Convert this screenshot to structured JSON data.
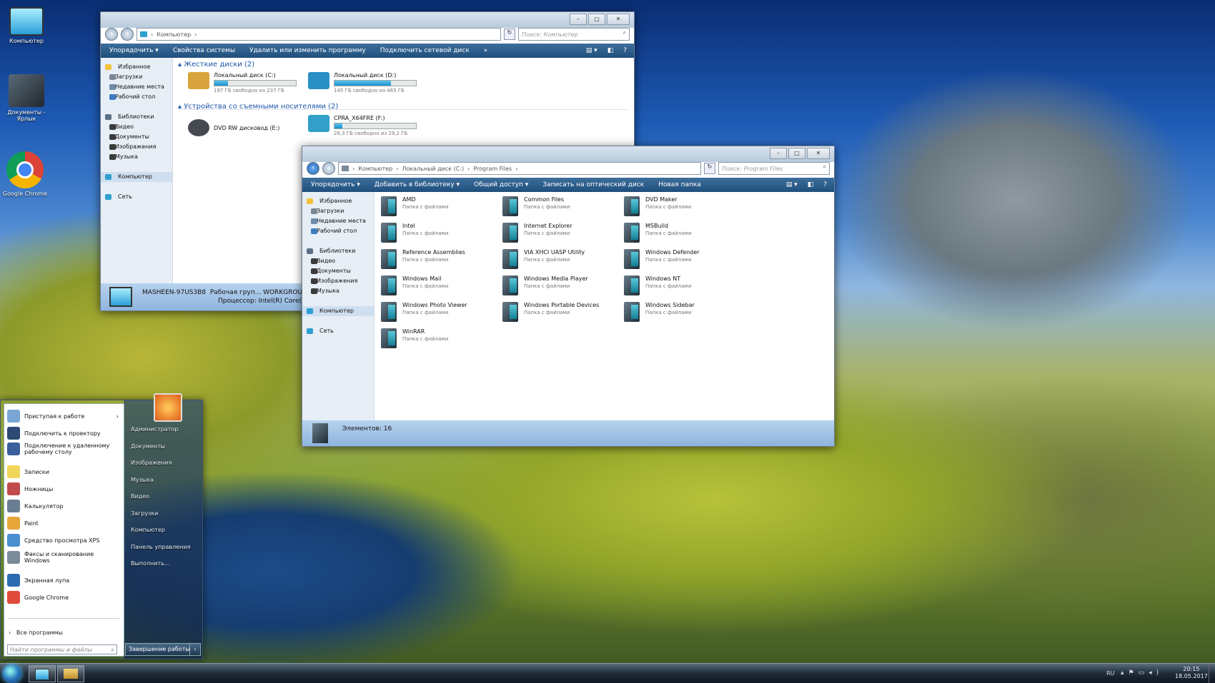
{
  "desktop": {
    "icons": [
      {
        "label": "Компьютер"
      },
      {
        "label": "Документы - Ярлык"
      },
      {
        "label": "Google Chrome"
      }
    ]
  },
  "window1": {
    "address": [
      "Компьютер"
    ],
    "search_placeholder": "Поиск: Компьютер",
    "toolbar": [
      "Упорядочить ▾",
      "Свойства системы",
      "Удалить или изменить программу",
      "Подключить сетевой диск",
      "»"
    ],
    "nav": [
      {
        "label": "Избранное",
        "group": true,
        "color": "#f2c23a"
      },
      {
        "label": "Загрузки",
        "group": false,
        "color": "#7b8896"
      },
      {
        "label": "Недавние места",
        "group": false,
        "color": "#6f8aa6"
      },
      {
        "label": "Рабочий стол",
        "group": false,
        "color": "#3d7bc2"
      },
      {
        "label": "Библиотеки",
        "group": true,
        "color": "#5c6f84"
      },
      {
        "label": "Видео",
        "group": false,
        "color": "#3b3b3b"
      },
      {
        "label": "Документы",
        "group": false,
        "color": "#3b3b3b"
      },
      {
        "label": "Изображения",
        "group": false,
        "color": "#3b3b3b"
      },
      {
        "label": "Музыка",
        "group": false,
        "color": "#3b3b3b"
      },
      {
        "label": "Компьютер",
        "group": true,
        "sel": true,
        "color": "#2f9fd1"
      },
      {
        "label": "Сеть",
        "group": true,
        "color": "#2f9fd1"
      }
    ],
    "group1": "Жесткие диски (2)",
    "group2": "Устройства со съемными носителями (2)",
    "drives": [
      {
        "name": "Локальный диск (C:)",
        "free": "197 ГБ свободно из 237 ГБ",
        "used": 0.17,
        "color": "#d9a33d"
      },
      {
        "name": "Локальный диск (D:)",
        "free": "145 ГБ свободно из 465 ГБ",
        "used": 0.69,
        "color": "#2a8fc4"
      },
      {
        "name": "DVD RW дисковод (E:)",
        "free": "",
        "used": null,
        "color": "#444a50"
      },
      {
        "name": "CPRA_X64FRE (F:)",
        "free": "26,3 ГБ свободно из 29,2 ГБ",
        "used": 0.1,
        "color": "#32a0c8"
      }
    ],
    "status": {
      "computer": "MASHEEN-97US3B8",
      "workgroup": "Рабочая груп... WORKGROUP",
      "cpu": "Процессор: Intel(R) Core(T"
    }
  },
  "window2": {
    "address": [
      "Компьютер",
      "Локальный диск (C:)",
      "Program Files"
    ],
    "search_placeholder": "Поиск: Program Files",
    "toolbar": [
      "Упорядочить ▾",
      "Добавить в библиотеку ▾",
      "Общий доступ ▾",
      "Записать на оптический диск",
      "Новая папка"
    ],
    "nav": [
      {
        "label": "Избранное",
        "group": true,
        "color": "#f2c23a"
      },
      {
        "label": "Загрузки",
        "group": false,
        "color": "#7b8896"
      },
      {
        "label": "Недавние места",
        "group": false,
        "color": "#6f8aa6"
      },
      {
        "label": "Рабочий стол",
        "group": false,
        "color": "#3d7bc2"
      },
      {
        "label": "Библиотеки",
        "group": true,
        "color": "#5c6f84"
      },
      {
        "label": "Видео",
        "group": false,
        "color": "#3b3b3b"
      },
      {
        "label": "Документы",
        "group": false,
        "color": "#3b3b3b"
      },
      {
        "label": "Изображения",
        "group": false,
        "color": "#3b3b3b"
      },
      {
        "label": "Музыка",
        "group": false,
        "color": "#3b3b3b"
      },
      {
        "label": "Компьютер",
        "group": true,
        "sel": true,
        "color": "#2f9fd1"
      },
      {
        "label": "Сеть",
        "group": true,
        "color": "#2f9fd1"
      }
    ],
    "folder_sub": "Папка с файлами",
    "folders": [
      "AMD",
      "Common Files",
      "DVD Maker",
      "Intel",
      "Internet Explorer",
      "MSBuild",
      "Reference Assemblies",
      "VIA XHCI UASP Utility",
      "Windows Defender",
      "Windows Mail",
      "Windows Media Player",
      "Windows NT",
      "Windows Photo Viewer",
      "Windows Portable Devices",
      "Windows Sidebar",
      "WinRAR"
    ],
    "status": "Элементов: 16"
  },
  "startmenu": {
    "items": [
      {
        "label": "Приступая к работе",
        "arrow": "›",
        "color": "#7aa6d6"
      },
      {
        "label": "Подключить к проектору",
        "color": "#2c4a74"
      },
      {
        "label": "Подключение к удаленному рабочему столу",
        "color": "#3b5f9c"
      },
      {
        "label": "Записки",
        "color": "#f0d65a"
      },
      {
        "label": "Ножницы",
        "color": "#c24a4a"
      },
      {
        "label": "Калькулятор",
        "color": "#6a7e92"
      },
      {
        "label": "Paint",
        "color": "#e6a63a"
      },
      {
        "label": "Средство просмотра XPS",
        "color": "#4a8fd0"
      },
      {
        "label": "Факсы и сканирование Windows",
        "color": "#7a8a99"
      },
      {
        "label": "Экранная лупа",
        "color": "#2d6bb0"
      },
      {
        "label": "Google Chrome",
        "color": "#e04a3a"
      }
    ],
    "all_programs": "Все программы",
    "search_placeholder": "Найти программы и файлы",
    "right": [
      "Администратор",
      "Документы",
      "Изображения",
      "Музыка",
      "Видео",
      "Загрузки",
      "Компьютер",
      "Панель управления",
      "Выполнить..."
    ],
    "shutdown": "Завершение работы"
  },
  "tray": {
    "lang": "RU",
    "time": "20:15",
    "date": "18.05.2017"
  }
}
